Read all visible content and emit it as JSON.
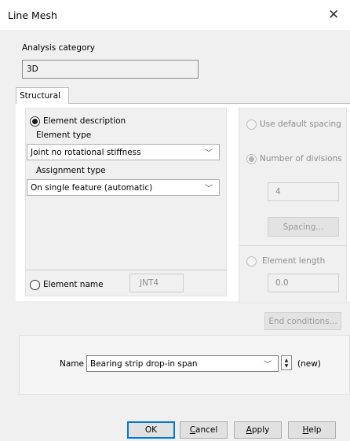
{
  "window": {
    "title": "Line Mesh",
    "close_label": "✕"
  },
  "analysis": {
    "label": "Analysis category",
    "value": "3D"
  },
  "tabs": [
    {
      "label": "Structural"
    }
  ],
  "element_description": {
    "radio_label": "Element description",
    "element_type_label": "Element type",
    "element_type_value": "Joint no rotational stiffness",
    "assignment_type_label": "Assignment type",
    "assignment_type_value": "On single feature (automatic)"
  },
  "element_name": {
    "radio_label": "Element name",
    "value": "JNT4"
  },
  "spacing": {
    "use_default_label": "Use default spacing",
    "number_of_divisions_label": "Number of divisions",
    "divisions_value": "4",
    "spacing_button": "Spacing...",
    "element_length_label": "Element length",
    "element_length_value": "0.0"
  },
  "end_conditions_button": "End conditions...",
  "name_row": {
    "label": "Name",
    "value": "Bearing strip drop-in span",
    "status": "(new)"
  },
  "buttons": {
    "ok": "OK",
    "cancel_first": "C",
    "cancel_rest": "ancel",
    "apply_first": "A",
    "apply_rest": "pply",
    "help_first": "H",
    "help_rest": "elp"
  }
}
